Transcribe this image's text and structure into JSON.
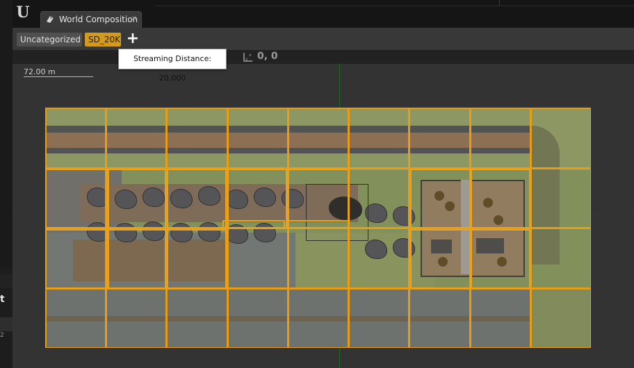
{
  "app": {
    "tab_title": "World Composition",
    "tab_close": "×",
    "logo": "U"
  },
  "filters": {
    "uncategorized_label": "Uncategorized",
    "sd_label": "SD_20K",
    "add_label": "+"
  },
  "tooltip": {
    "text": "Streaming Distance: 20,000"
  },
  "viewport": {
    "coords": "0, 0",
    "scale_label": "72.00 m"
  },
  "left_panel": {
    "label_t": "t",
    "label_2": "2"
  },
  "colors": {
    "tile_border": "#e89d14",
    "sd_button": "#d39a1b",
    "axis_x": "#6a1f1f",
    "axis_y": "#1f6b1f"
  },
  "icons": {
    "logo": "unreal-logo-icon",
    "tab": "world-composition-icon",
    "coords": "axis-icon"
  }
}
